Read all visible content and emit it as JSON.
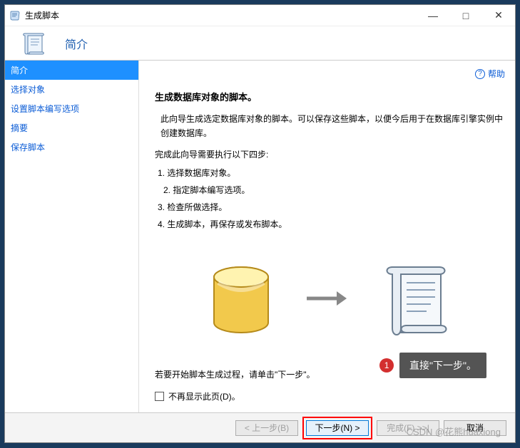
{
  "window": {
    "title": "生成脚本"
  },
  "header": {
    "title": "简介"
  },
  "sidebar": {
    "items": [
      {
        "label": "简介",
        "selected": true
      },
      {
        "label": "选择对象",
        "selected": false
      },
      {
        "label": "设置脚本编写选项",
        "selected": false
      },
      {
        "label": "摘要",
        "selected": false
      },
      {
        "label": "保存脚本",
        "selected": false
      }
    ]
  },
  "content": {
    "help_label": "帮助",
    "heading": "生成数据库对象的脚本。",
    "description": "此向导生成选定数据库对象的脚本。可以保存这些脚本，以便今后用于在数据库引擎实例中创建数据库。",
    "steps_intro": "完成此向导需要执行以下四步:",
    "steps": [
      "1. 选择数据库对象。",
      "2. 指定脚本编写选项。",
      "3. 检查所做选择。",
      "4. 生成脚本，再保存或发布脚本。"
    ],
    "final_note": "若要开始脚本生成过程，请单击\"下一步\"。",
    "checkbox_label": "不再显示此页(D)。"
  },
  "footer": {
    "back": "< 上一步(B)",
    "next": "下一步(N) >",
    "finish": "完成(F) >>|",
    "cancel": "取消"
  },
  "annotation": {
    "num": "1",
    "text": "直接\"下一步\"。"
  },
  "watermark": "CSDN @花熊huaxiong"
}
